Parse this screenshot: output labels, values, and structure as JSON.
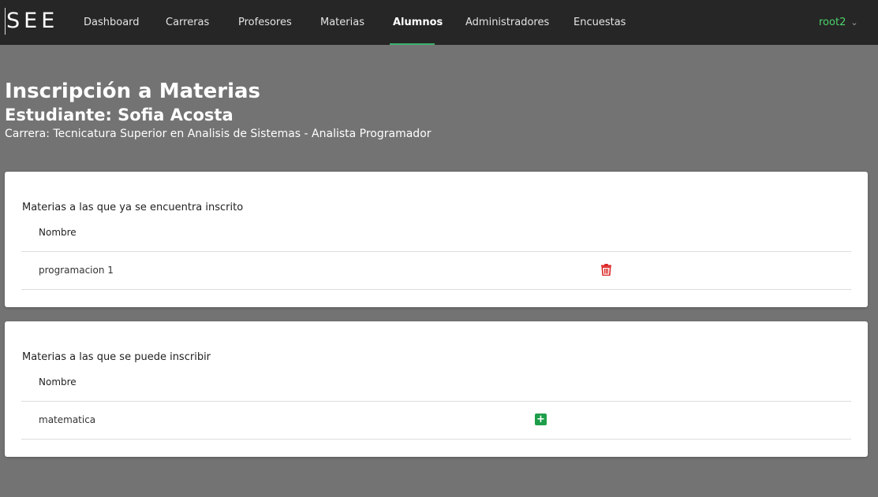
{
  "navbar": {
    "brand": "SEE",
    "items": [
      {
        "label": "Dashboard"
      },
      {
        "label": "Carreras"
      },
      {
        "label": "Profesores"
      },
      {
        "label": "Materias"
      },
      {
        "label": "Alumnos",
        "active": true
      },
      {
        "label": "Administradores"
      },
      {
        "label": "Encuestas"
      }
    ],
    "user": "root2",
    "accent_color": "#3cb371",
    "user_color": "#4cd46a"
  },
  "page": {
    "title": "Inscripción a Materias",
    "student": "Estudiante: Sofia Acosta",
    "career": "Carrera: Tecnicatura Superior en Analisis de Sistemas - Analista Programador"
  },
  "enrolled": {
    "title": "Materias a las que ya se encuentra inscrito",
    "column": "Nombre",
    "rows": [
      {
        "name": "programacion 1",
        "action_icon": "trash-icon"
      }
    ],
    "action_color": "#dc2626"
  },
  "available": {
    "title": "Materias a las que se puede inscribir",
    "column": "Nombre",
    "rows": [
      {
        "name": "matematica",
        "action_icon": "plus-icon"
      }
    ],
    "action_color": "#1e9e4a"
  }
}
